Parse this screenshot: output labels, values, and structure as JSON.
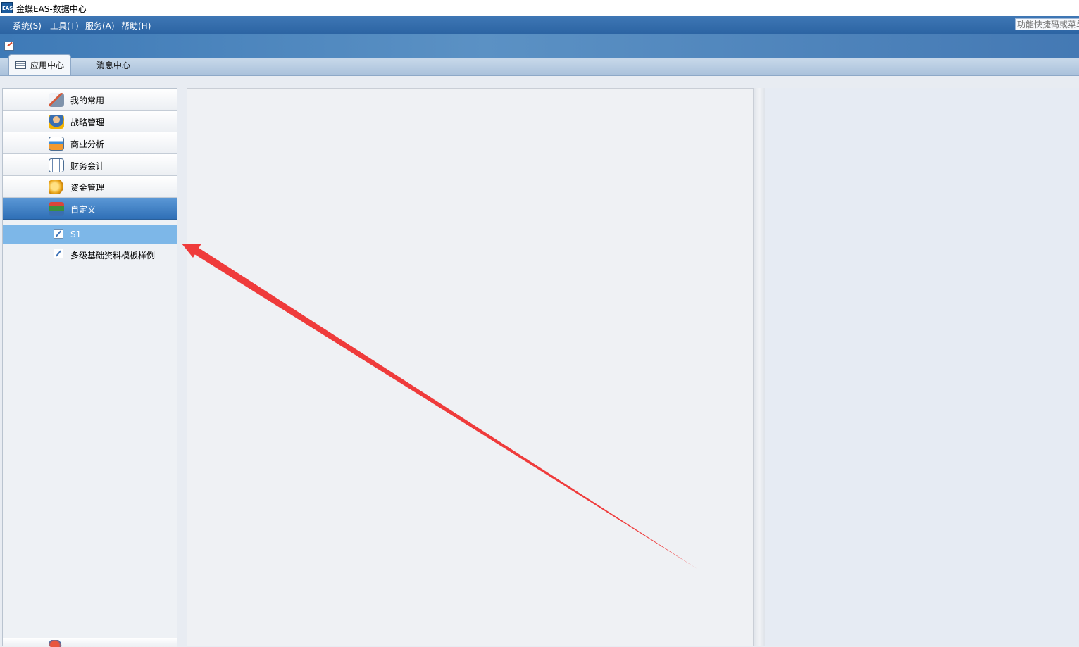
{
  "window": {
    "icon_label": "EAS",
    "title": "金蝶EAS-数据中心"
  },
  "menubar": {
    "items": [
      "系统(S)",
      "工具(T)",
      "服务(A)",
      "帮助(H)"
    ],
    "shortcut_placeholder": "功能快捷码或菜单"
  },
  "tabs": [
    {
      "label": "应用中心",
      "active": true
    },
    {
      "label": "消息中心",
      "active": false
    }
  ],
  "nav": {
    "groups": [
      {
        "label": "我的常用",
        "icon": "writing-hand-icon"
      },
      {
        "label": "战略管理",
        "icon": "manager-person-icon"
      },
      {
        "label": "商业分析",
        "icon": "analysis-chart-icon"
      },
      {
        "label": "财务会计",
        "icon": "finance-calendar-icon"
      },
      {
        "label": "资金管理",
        "icon": "money-coins-icon"
      },
      {
        "label": "自定义",
        "icon": "stacked-books-icon",
        "selected": true
      }
    ],
    "subitems": [
      {
        "label": "S1",
        "icon": "edit-document-icon",
        "selected": true
      },
      {
        "label": "多级基础资料模板样例",
        "icon": "edit-document-icon",
        "selected": false
      }
    ]
  },
  "colors": {
    "menubar": "#2c64a3",
    "selected_group": "#3f7fc2",
    "selected_item": "#7db7e8",
    "annotation_arrow": "#ef3b3b"
  }
}
